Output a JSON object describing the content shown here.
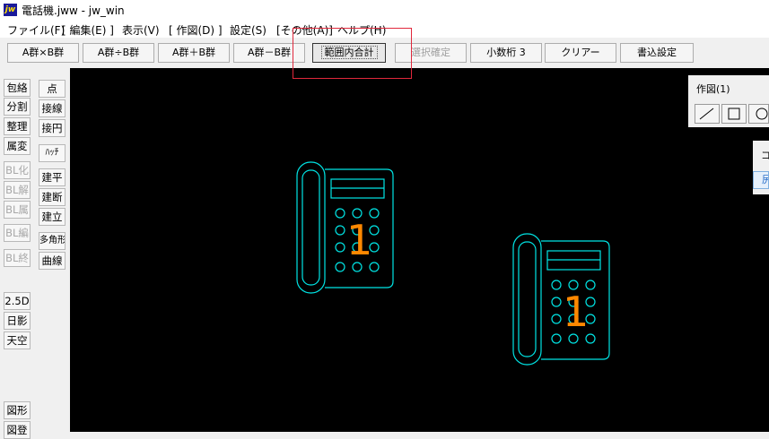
{
  "window": {
    "icon_text": "jw",
    "title": "電話機.jww - jw_win"
  },
  "menu": [
    "ファイル(F)",
    "[ 編集(E) ]",
    "表示(V)",
    "[ 作図(D) ]",
    "設定(S)",
    "[その他(A)]",
    "ヘルプ(H)"
  ],
  "toolbar": {
    "buttons": [
      "A群×B群",
      "A群÷B群",
      "A群＋B群",
      "A群－B群",
      "範囲内合計",
      "選択確定",
      "小数桁 3",
      "クリアー",
      "書込設定"
    ],
    "pressed": "範囲内合計",
    "disabled": [
      "選択確定"
    ]
  },
  "left_toolbar": {
    "col1": [
      "包絡",
      "分割",
      "整理",
      "属変",
      "BL化",
      "BL解",
      "BL属",
      "BL編",
      "BL終",
      "2.5D",
      "日影",
      "天空",
      "図形",
      "図登"
    ],
    "col2": [
      "点",
      "接線",
      "接円",
      "ﾊｯﾁ",
      "建平",
      "建断",
      "建立",
      "多角形",
      "曲線"
    ],
    "disabled": [
      "BL化",
      "BL解",
      "BL属",
      "BL編",
      "BL終"
    ]
  },
  "sakuzu_panel": {
    "title": "作図(1)",
    "tools": [
      "line-tool-icon",
      "rectangle-tool-icon",
      "circle-tool-icon"
    ]
  },
  "panel_2": {
    "top_text": "コ",
    "button_text": "尻"
  },
  "drawing": {
    "line_color": "#00e5e5",
    "number_color": "#ff8800",
    "phones": [
      {
        "label": "1"
      },
      {
        "label": "1"
      }
    ]
  },
  "colors": {
    "highlight": "#e0283c",
    "canvas_bg": "#000000"
  }
}
